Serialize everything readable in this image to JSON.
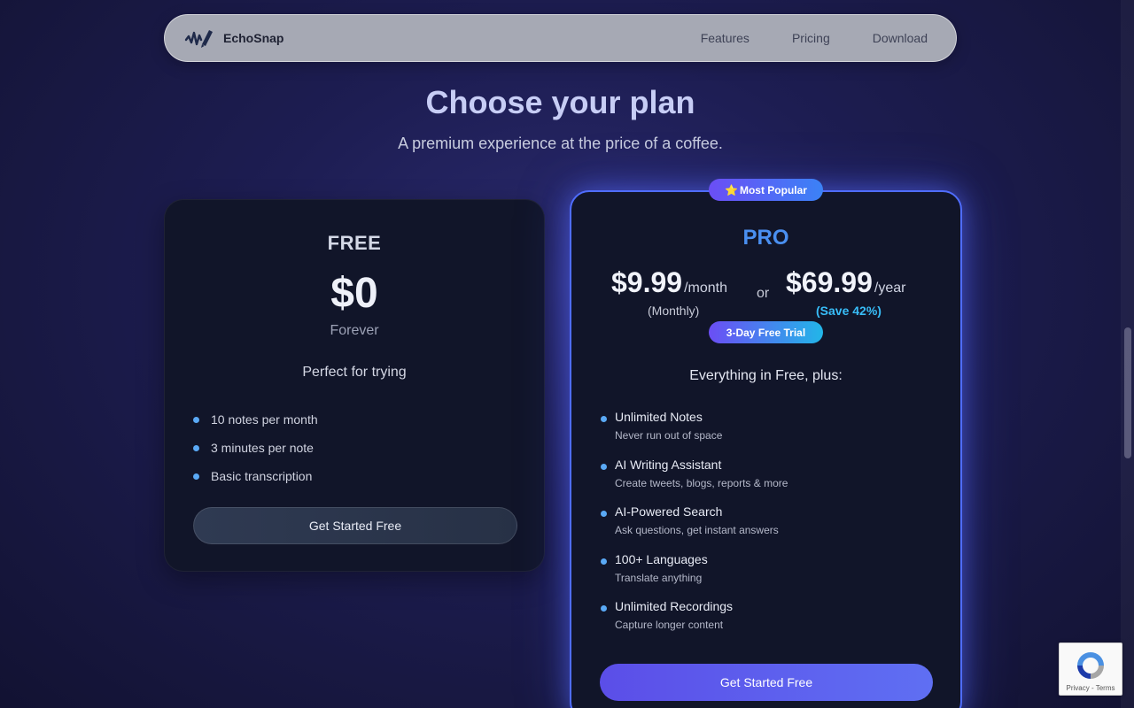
{
  "navbar": {
    "brand": "EchoSnap",
    "links": [
      "Features",
      "Pricing",
      "Download"
    ]
  },
  "hero": {
    "title": "Choose your plan",
    "subtitle": "A premium experience at the price of a coffee."
  },
  "free_plan": {
    "name": "FREE",
    "price": "$0",
    "period": "Forever",
    "tagline": "Perfect for trying",
    "features": [
      "10 notes per month",
      "3 minutes per note",
      "Basic transcription"
    ],
    "cta": "Get Started Free"
  },
  "pro_plan": {
    "badge": "Most Popular",
    "badge_icon": "star-icon",
    "name": "PRO",
    "monthly_price": "$9.99",
    "monthly_unit": "/month",
    "monthly_note": "(Monthly)",
    "or": "or",
    "yearly_price": "$69.99",
    "yearly_unit": "/year",
    "yearly_note": "(Save 42%)",
    "trial": "3-Day Free Trial",
    "intro": "Everything in Free, plus:",
    "features": [
      {
        "title": "Unlimited Notes",
        "subtitle": "Never run out of space"
      },
      {
        "title": "AI Writing Assistant",
        "subtitle": "Create tweets, blogs, reports & more"
      },
      {
        "title": "AI-Powered Search",
        "subtitle": "Ask questions, get instant answers"
      },
      {
        "title": "100+ Languages",
        "subtitle": "Translate anything"
      },
      {
        "title": "Unlimited Recordings",
        "subtitle": "Capture longer content"
      }
    ],
    "cta": "Get Started Free"
  },
  "recaptcha": {
    "privacy": "Privacy",
    "separator": "-",
    "terms": "Terms"
  },
  "colors": {
    "accent": "#4f6dff",
    "pro_title": "#4a8ff0",
    "savings": "#38bdf8",
    "bullet": "#5aa9f5"
  }
}
